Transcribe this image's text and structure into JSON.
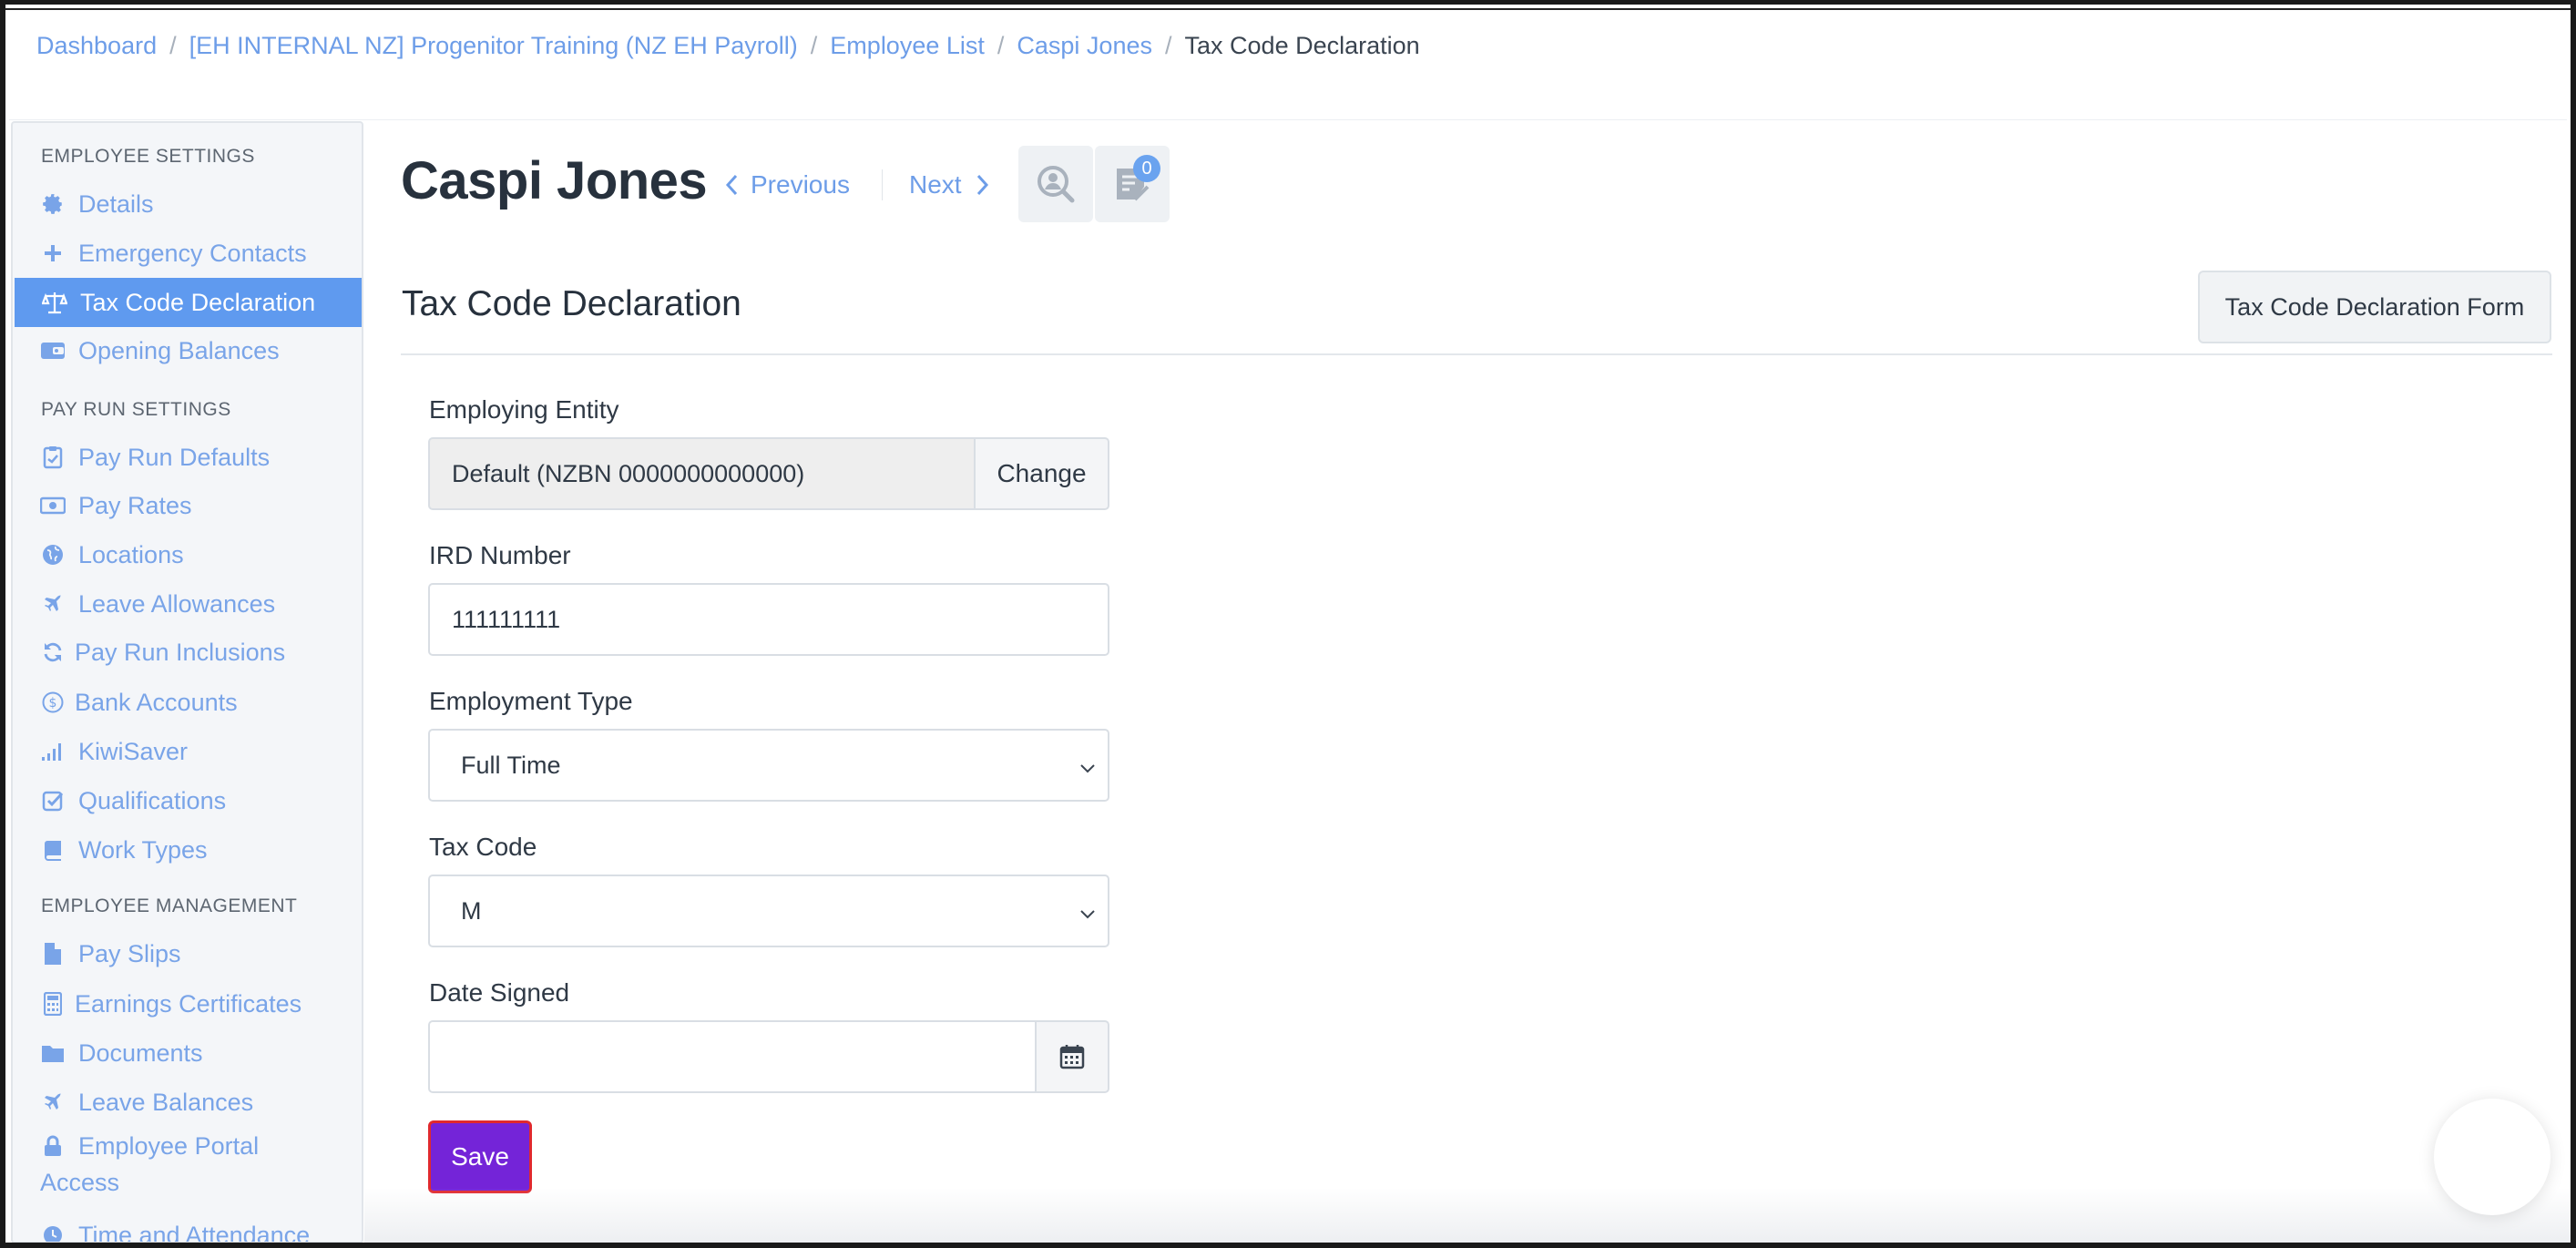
{
  "breadcrumb": {
    "items": [
      "Dashboard",
      "[EH INTERNAL NZ] Progenitor Training (NZ EH Payroll)",
      "Employee List",
      "Caspi Jones"
    ],
    "current": "Tax Code Declaration",
    "separator": "/"
  },
  "sidebar": {
    "sections": [
      "EMPLOYEE SETTINGS",
      "PAY RUN SETTINGS",
      "EMPLOYEE MANAGEMENT"
    ],
    "items": [
      {
        "label": "Details",
        "icon": "gear-icon"
      },
      {
        "label": "Emergency Contacts",
        "icon": "plus-icon"
      },
      {
        "label": "Tax Code Declaration",
        "icon": "scales-icon",
        "active": true
      },
      {
        "label": "Opening Balances",
        "icon": "wallet-icon"
      },
      {
        "label": "Pay Run Defaults",
        "icon": "clipboard-icon"
      },
      {
        "label": "Pay Rates",
        "icon": "money-icon"
      },
      {
        "label": "Locations",
        "icon": "globe-icon"
      },
      {
        "label": "Leave Allowances",
        "icon": "plane-icon"
      },
      {
        "label": "Pay Run Inclusions",
        "icon": "refresh-icon"
      },
      {
        "label": "Bank Accounts",
        "icon": "dollar-circle-icon"
      },
      {
        "label": "KiwiSaver",
        "icon": "bar-signal-icon"
      },
      {
        "label": "Qualifications",
        "icon": "checkbox-icon"
      },
      {
        "label": "Work Types",
        "icon": "book-icon"
      },
      {
        "label": "Pay Slips",
        "icon": "file-icon"
      },
      {
        "label": "Earnings Certificates",
        "icon": "calculator-icon"
      },
      {
        "label": "Documents",
        "icon": "folder-icon"
      },
      {
        "label": "Leave Balances",
        "icon": "plane-icon"
      },
      {
        "label": "Employee Portal Access",
        "icon": "lock-icon"
      },
      {
        "label": "Time and Attendance",
        "icon": "clock-icon"
      }
    ]
  },
  "header": {
    "employee_name": "Caspi Jones",
    "previous_label": "Previous",
    "next_label": "Next",
    "notes_badge": "0"
  },
  "section": {
    "title": "Tax Code Declaration",
    "form_button": "Tax Code Declaration Form"
  },
  "form": {
    "employing_entity": {
      "label": "Employing Entity",
      "value": "Default (NZBN 0000000000000)",
      "action": "Change"
    },
    "ird_number": {
      "label": "IRD Number",
      "value": "111111111"
    },
    "employment_type": {
      "label": "Employment Type",
      "value": "Full Time"
    },
    "tax_code": {
      "label": "Tax Code",
      "value": "M"
    },
    "date_signed": {
      "label": "Date Signed",
      "value": ""
    },
    "save_label": "Save"
  },
  "colors": {
    "link": "#6d9de8",
    "sidebar_active": "#5f9aef",
    "save_button": "#7424d8",
    "save_border": "#e0292e"
  }
}
